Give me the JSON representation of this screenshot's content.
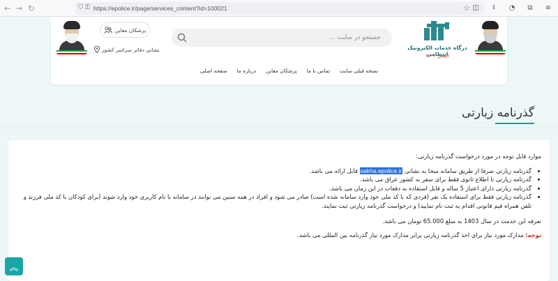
{
  "browser": {
    "url": "https://epolice.ir/page/services_content?id=100021",
    "back_icon": "arrow-left-icon",
    "forward_icon": "arrow-right-icon"
  },
  "header": {
    "logo_title": "درگاه خدمات الکترونیک انتظامی",
    "logo_subtitle": "(پلیس +۱۰)",
    "search_placeholder": "جستجو در سایت ...",
    "doctors_button": "پزشکان معاین",
    "offices_link": "نشانی دفاتر سراسر کشور",
    "nav": [
      "صفحه اصلی",
      "درباره ما",
      "پزشکان معاین",
      "تماس با ما",
      "نسخه قبلی سایت"
    ]
  },
  "page": {
    "title": "گذرنامه زیارتی",
    "intro": "موارد قابل توجه در مورد درخواست گذرنامه زیارتی:",
    "rule1_before": "گذرنامه زیارتی صرفا از طریق سامانه سخا به نشانی",
    "rule1_link": "sakha.epolice.ir",
    "rule1_after": "قابل ارائه می باشد.",
    "rule2": "گذرنامه زیارتی تا اطلاع ثانوی فقط برای سفر به کشور عراق می باشد.",
    "rule3": "گذرنامه زیارتی دارای اعتبار 5 ساله و قابل استفاده به دفعات در این زمان می باشد.",
    "rule4": "گذرنامه زیارتی فقط برای استفاده یک نفر (فردی که با کد ملی خود وارد سامانه شده است) صادر می شود و افراد در همه سنین می توانند در سامانه با نام کاربری خود وارد شوند (برای کودکان با کد ملی فرزند و تلفن همراه قیم قانونی اقدام به ثبت نام نمایید) و درخواست گذرنامه زیارتی ثبت نمایند.",
    "fee": "تعرفه این خدمت در سال 1403 به مبلغ 65.000 تومان می باشد.",
    "note_label": "توجه:",
    "note_text": " مدارک مورد نیاز برای اخذ گذرنامه زیارتی برابر مدارک مورد نیاز گذرنامه بین المللی می باشد."
  },
  "colors": {
    "accent": "#2f8f95",
    "scroll_button": "#1aa6a6",
    "highlight": "#2d6fd6",
    "note": "#d12a2a"
  }
}
